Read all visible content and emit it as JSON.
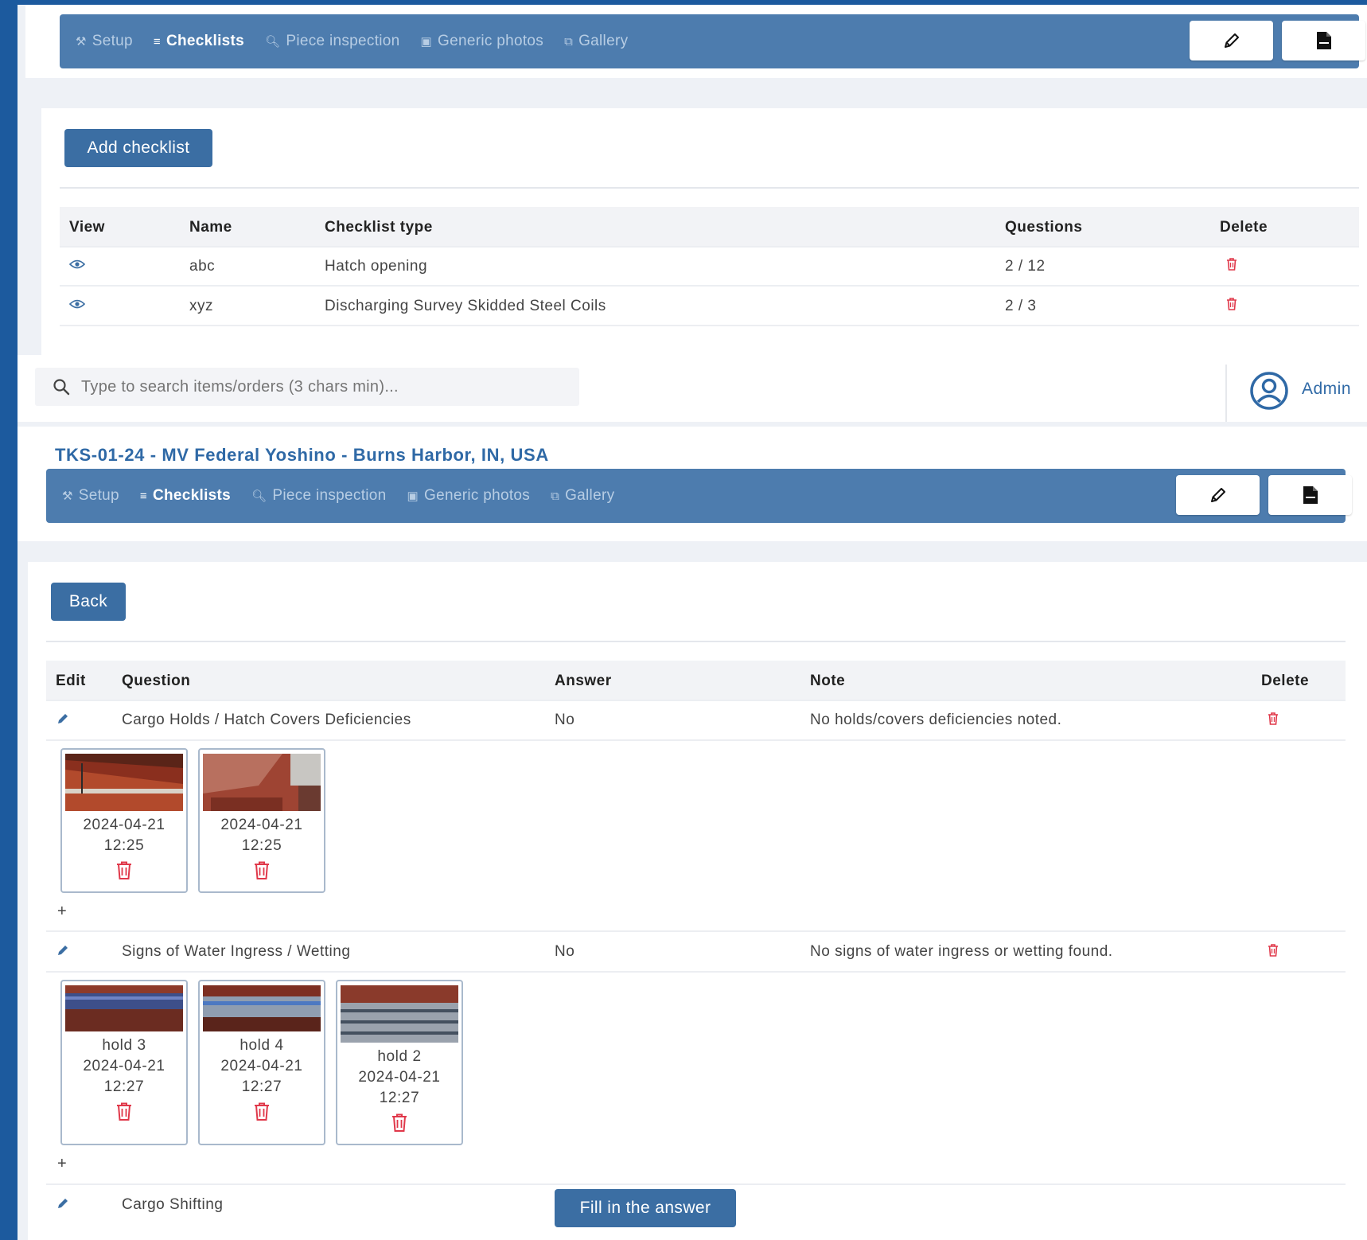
{
  "nav": {
    "items": [
      {
        "label": "Setup",
        "icon": "wrench-icon"
      },
      {
        "label": "Checklists",
        "icon": "list-icon"
      },
      {
        "label": "Piece inspection",
        "icon": "magnifier-icon"
      },
      {
        "label": "Generic photos",
        "icon": "image-icon"
      },
      {
        "label": "Gallery",
        "icon": "images-icon"
      }
    ],
    "active": "Checklists",
    "accent": "#4d7cae"
  },
  "checklists": {
    "add_label": "Add checklist",
    "columns": [
      "View",
      "Name",
      "Checklist type",
      "Questions",
      "Delete"
    ],
    "rows": [
      {
        "name": "abc",
        "type": "Hatch opening",
        "questions": "2 / 12"
      },
      {
        "name": "xyz",
        "type": "Discharging Survey Skidded Steel Coils",
        "questions": "2 / 3"
      }
    ]
  },
  "search": {
    "placeholder": "Type to search items/orders (3 chars min)..."
  },
  "user": {
    "name": "Admin"
  },
  "order": {
    "title": "TKS-01-24 - MV Federal Yoshino - Burns Harbor, IN, USA"
  },
  "detail": {
    "back_label": "Back",
    "columns": [
      "Edit",
      "Question",
      "Answer",
      "Note",
      "Delete"
    ],
    "questions": [
      {
        "question": "Cargo Holds / Hatch Covers Deficiencies",
        "answer": "No",
        "note": "No holds/covers deficiencies noted.",
        "photos": [
          {
            "caption": "",
            "date": "2024-04-21",
            "time": "12:25"
          },
          {
            "caption": "",
            "date": "2024-04-21",
            "time": "12:25"
          }
        ],
        "add": "+"
      },
      {
        "question": "Signs of Water Ingress / Wetting",
        "answer": "No",
        "note": "No signs of water ingress or wetting found.",
        "photos": [
          {
            "caption": "hold 3",
            "date": "2024-04-21",
            "time": "12:27"
          },
          {
            "caption": "hold 4",
            "date": "2024-04-21",
            "time": "12:27"
          },
          {
            "caption": "hold 2",
            "date": "2024-04-21",
            "time": "12:27"
          }
        ],
        "add": "+"
      },
      {
        "question": "Cargo Shifting",
        "fill_label": "Fill in the answer"
      }
    ]
  },
  "colors": {
    "primary": "#3b6ea3",
    "danger": "#e0384a",
    "title": "#2f69a6"
  }
}
